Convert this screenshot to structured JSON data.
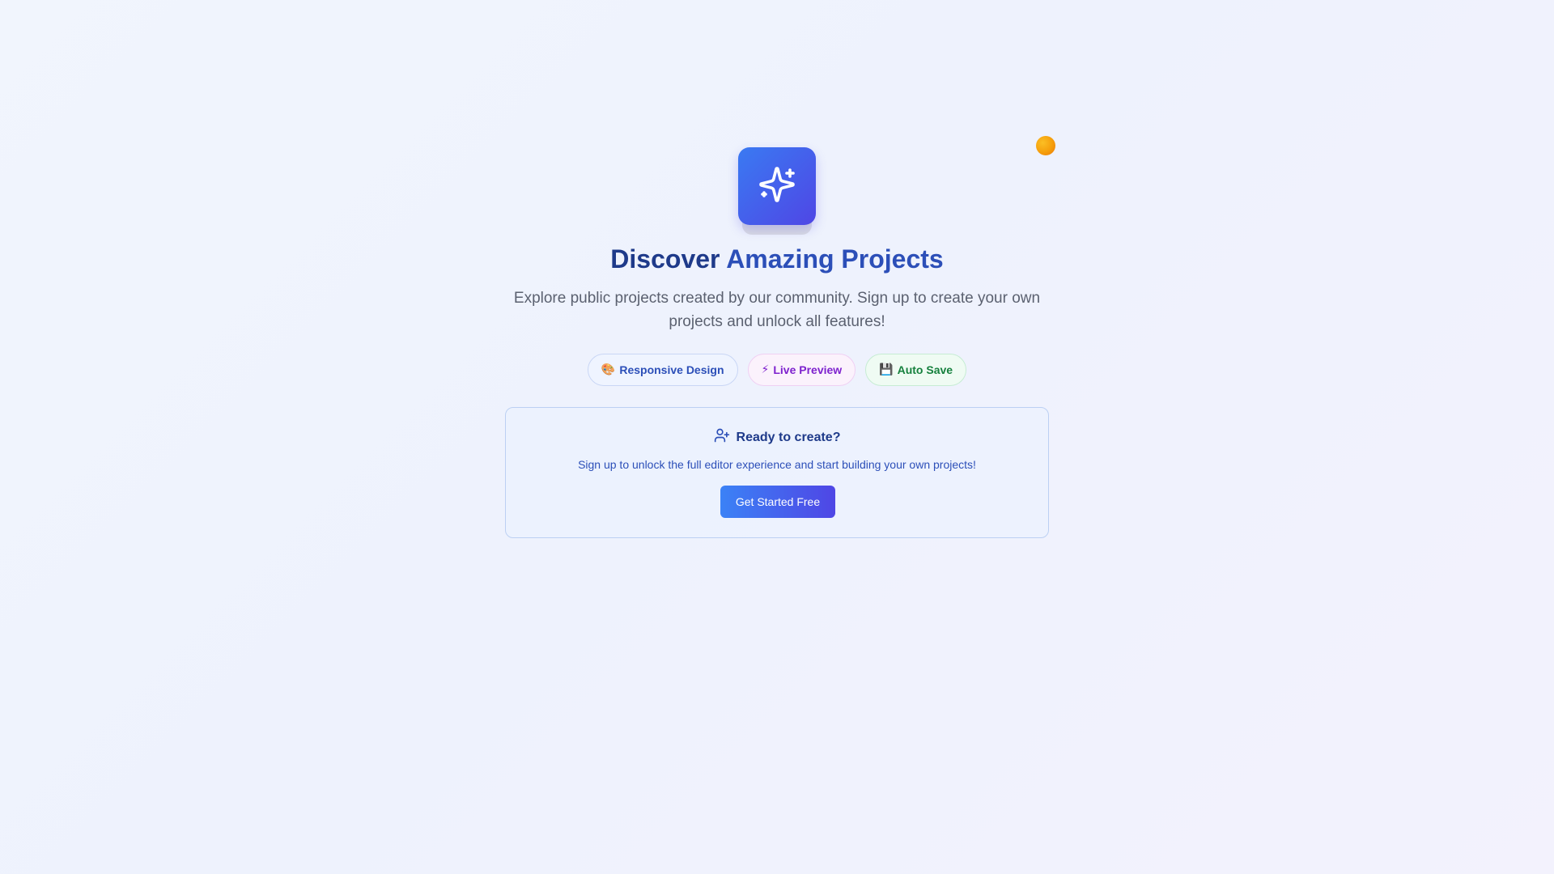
{
  "hero": {
    "logo_icon": "sparkles-icon",
    "title_main": "Discover",
    "title_accent": "Amazing Projects",
    "subtitle": "Explore public projects created by our community. Sign up to create your own projects and unlock all features!"
  },
  "features": [
    {
      "emoji": "🎨",
      "label": "Responsive Design",
      "color": "#2c4fb8"
    },
    {
      "emoji": "⚡",
      "label": "Live Preview",
      "color": "#7e22ce"
    },
    {
      "emoji": "💾",
      "label": "Auto Save",
      "color": "#15803d"
    }
  ],
  "cta": {
    "icon": "user-plus-icon",
    "title": "Ready to create?",
    "text": "Sign up to unlock the full editor experience and start building your own projects!",
    "button_label": "Get Started Free"
  },
  "colors": {
    "accent": "#4f46e5",
    "primary": "#3b82f6",
    "heading": "#1e3a8a",
    "dot": "#f59e0b"
  }
}
